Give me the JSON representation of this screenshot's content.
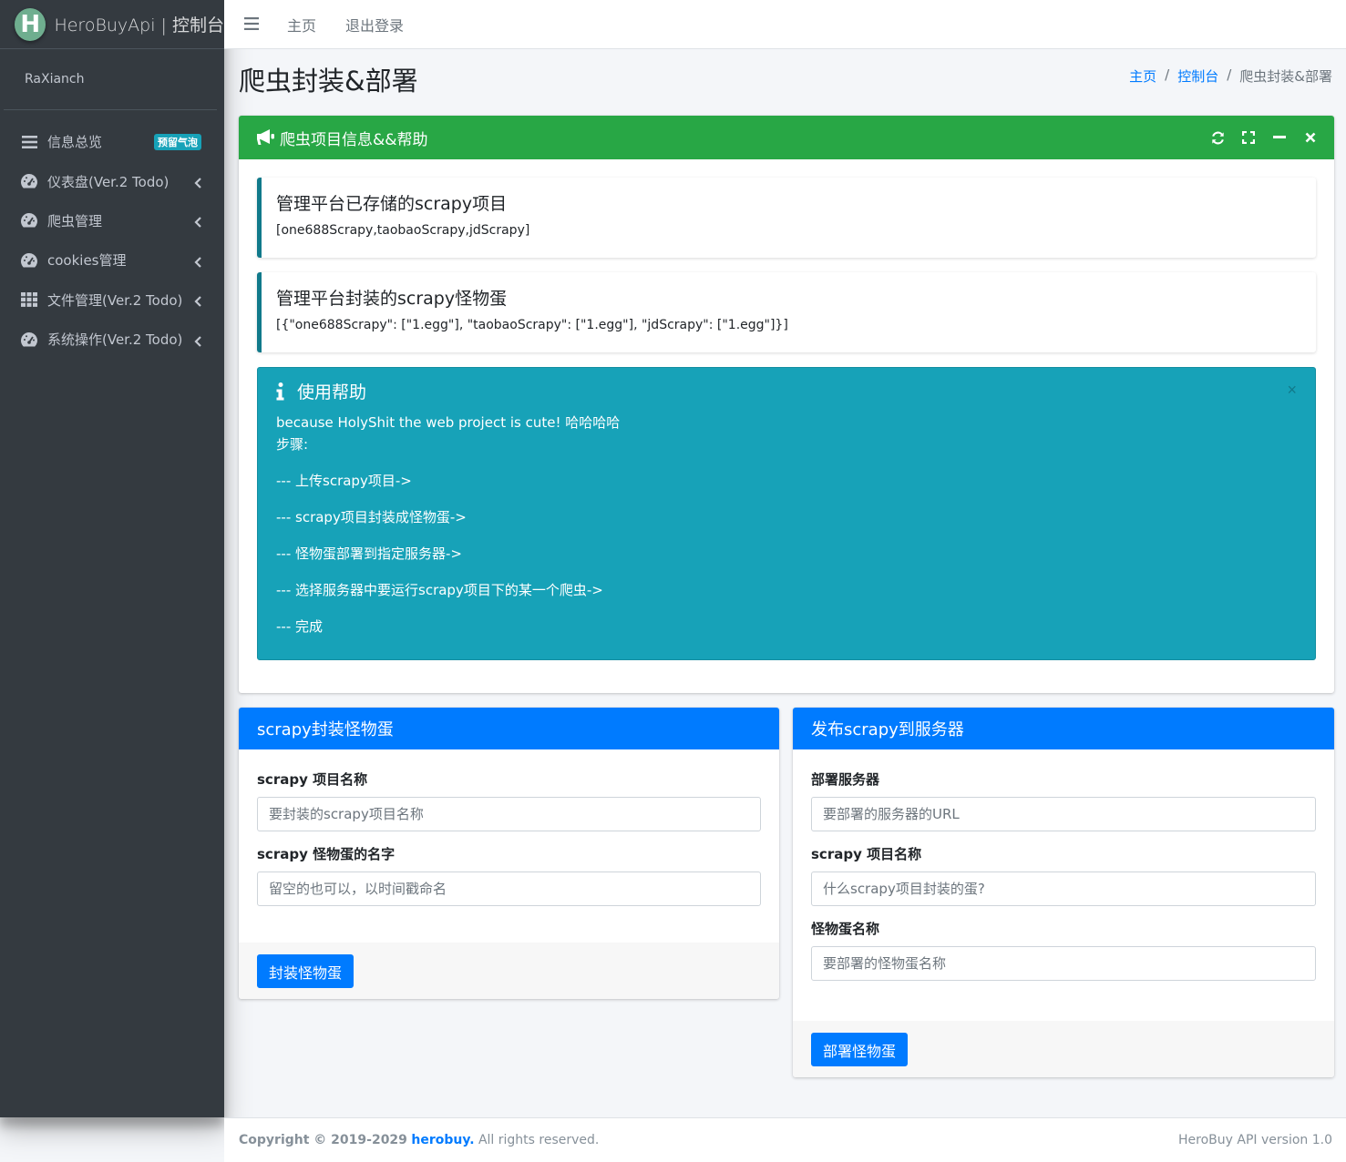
{
  "brand": {
    "logo_letter": "H",
    "name": "HeroBuyApi | 控制台"
  },
  "user": {
    "name": "RaXianch"
  },
  "sidebar": {
    "items": [
      {
        "label": "信息总览",
        "icon": "list-icon",
        "badge": "预留气泡"
      },
      {
        "label": "仪表盘(Ver.2 Todo)",
        "icon": "tachometer-icon"
      },
      {
        "label": "爬虫管理",
        "icon": "tachometer-icon"
      },
      {
        "label": "cookies管理",
        "icon": "tachometer-icon"
      },
      {
        "label": "文件管理(Ver.2 Todo)",
        "icon": "grid-icon"
      },
      {
        "label": "系统操作(Ver.2 Todo)",
        "icon": "tachometer-icon"
      }
    ]
  },
  "topbar": {
    "home": "主页",
    "logout": "退出登录"
  },
  "page": {
    "title": "爬虫封装&部署"
  },
  "breadcrumb": {
    "home": "主页",
    "dashboard": "控制台",
    "current": "爬虫封装&部署"
  },
  "main_card": {
    "title": "爬虫项目信息&&帮助",
    "callout1": {
      "title": "管理平台已存储的scrapy项目",
      "text": "[one688Scrapy,taobaoScrapy,jdScrapy]"
    },
    "callout2": {
      "title": "管理平台封装的scrapy怪物蛋",
      "text": "[{\"one688Scrapy\": [\"1.egg\"], \"taobaoScrapy\": [\"1.egg\"], \"jdScrapy\": [\"1.egg\"]}]"
    },
    "help": {
      "title": "使用帮助",
      "close": "×",
      "line1": "because HolyShit the web project is cute! 哈哈哈哈",
      "line2": "步骤:",
      "steps": [
        "--- 上传scrapy项目->",
        "--- scrapy项目封装成怪物蛋->",
        "--- 怪物蛋部署到指定服务器->",
        "--- 选择服务器中要运行scrapy项目下的某一个爬虫->",
        "--- 完成"
      ]
    }
  },
  "package_form": {
    "title": "scrapy封装怪物蛋",
    "project_label": "scrapy 项目名称",
    "project_placeholder": "要封装的scrapy项目名称",
    "egg_label": "scrapy 怪物蛋的名字",
    "egg_placeholder": "留空的也可以，以时间戳命名",
    "submit": "封装怪物蛋"
  },
  "deploy_form": {
    "title": "发布scrapy到服务器",
    "server_label": "部署服务器",
    "server_placeholder": "要部署的服务器的URL",
    "project_label": "scrapy 项目名称",
    "project_placeholder": "什么scrapy项目封装的蛋?",
    "egg_label": "怪物蛋名称",
    "egg_placeholder": "要部署的怪物蛋名称",
    "submit": "部署怪物蛋"
  },
  "footer": {
    "copyright": "Copyright © 2019-2029",
    "company": "herobuy.",
    "rights": "All rights reserved.",
    "version": "HeroBuy API version 1.0"
  },
  "colors": {
    "sidebar": "#343a40",
    "success": "#28a745",
    "primary": "#007bff",
    "info": "#17a2b8"
  }
}
